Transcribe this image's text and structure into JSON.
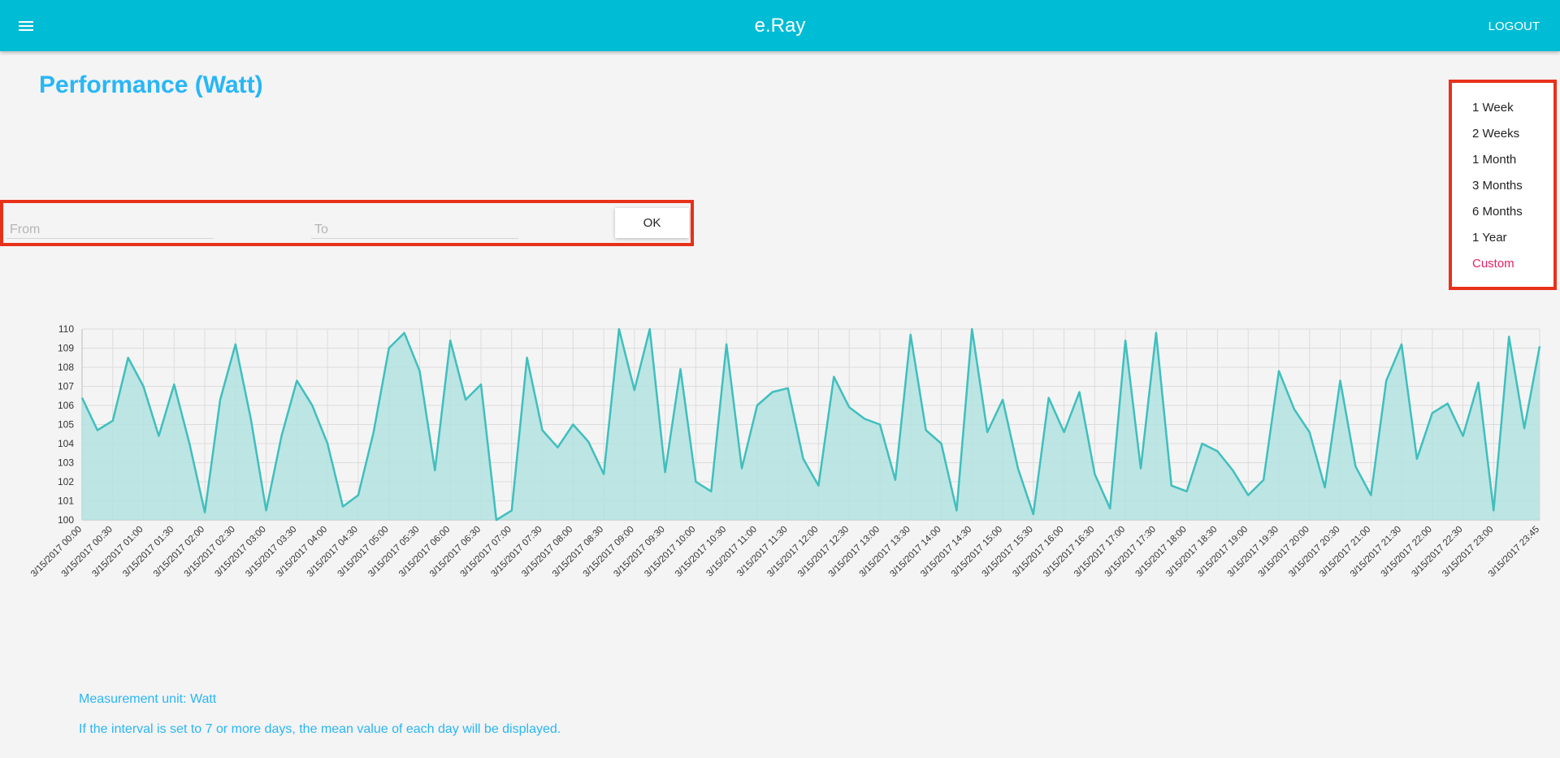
{
  "header": {
    "app_title": "e.Ray",
    "logout_label": "LOGOUT",
    "menu_icon": "menu-icon"
  },
  "page": {
    "title": "Performance (Watt)"
  },
  "filter": {
    "from_placeholder": "From",
    "to_placeholder": "To",
    "ok_label": "OK"
  },
  "ranges": [
    {
      "label": "1 Week",
      "active": false
    },
    {
      "label": "2 Weeks",
      "active": false
    },
    {
      "label": "1 Month",
      "active": false
    },
    {
      "label": "3 Months",
      "active": false
    },
    {
      "label": "6 Months",
      "active": false
    },
    {
      "label": "1 Year",
      "active": false
    },
    {
      "label": "Custom",
      "active": true
    }
  ],
  "colors": {
    "header": "#00bcd4",
    "accent": "#29b6f6",
    "active_range": "#e91e63",
    "line": "#3fbfbd",
    "fill": "#b2e2e1",
    "highlight_box": "#e8311a"
  },
  "notes": {
    "unit": "Measurement unit: Watt",
    "interval": "If the interval is set to 7 or more days, the mean value of each day will be displayed."
  },
  "chart_data": {
    "type": "area",
    "title": "",
    "xlabel": "",
    "ylabel": "",
    "ylim": [
      100,
      110
    ],
    "grid": true,
    "x_date": "3/15/2017",
    "x": [
      "00:00",
      "00:15",
      "00:30",
      "00:45",
      "01:00",
      "01:15",
      "01:30",
      "01:45",
      "02:00",
      "02:15",
      "02:30",
      "02:45",
      "03:00",
      "03:15",
      "03:30",
      "03:45",
      "04:00",
      "04:15",
      "04:30",
      "04:45",
      "05:00",
      "05:15",
      "05:30",
      "05:45",
      "06:00",
      "06:15",
      "06:30",
      "06:45",
      "07:00",
      "07:15",
      "07:30",
      "07:45",
      "08:00",
      "08:15",
      "08:30",
      "08:45",
      "09:00",
      "09:15",
      "09:30",
      "09:45",
      "10:00",
      "10:15",
      "10:30",
      "10:45",
      "11:00",
      "11:15",
      "11:30",
      "11:45",
      "12:00",
      "12:15",
      "12:30",
      "12:45",
      "13:00",
      "13:15",
      "13:30",
      "13:45",
      "14:00",
      "14:15",
      "14:30",
      "14:45",
      "15:00",
      "15:15",
      "15:30",
      "15:45",
      "16:00",
      "16:15",
      "16:30",
      "16:45",
      "17:00",
      "17:15",
      "17:30",
      "17:45",
      "18:00",
      "18:15",
      "18:30",
      "18:45",
      "19:00",
      "19:15",
      "19:30",
      "19:45",
      "20:00",
      "20:15",
      "20:30",
      "20:45",
      "21:00",
      "21:15",
      "21:30",
      "21:45",
      "22:00",
      "22:15",
      "22:30",
      "22:45",
      "23:00",
      "23:15",
      "23:30",
      "23:45"
    ],
    "x_tick_labels": [
      "3/15/2017  00:00",
      "3/15/2017  00:30",
      "3/15/2017  01:00",
      "3/15/2017  01:30",
      "3/15/2017  02:00",
      "3/15/2017  02:30",
      "3/15/2017  03:00",
      "3/15/2017  03:30",
      "3/15/2017  04:00",
      "3/15/2017  04:30",
      "3/15/2017  05:00",
      "3/15/2017  05:30",
      "3/15/2017  06:00",
      "3/15/2017  06:30",
      "3/15/2017  07:00",
      "3/15/2017  07:30",
      "3/15/2017  08:00",
      "3/15/2017  08:30",
      "3/15/2017  09:00",
      "3/15/2017  09:30",
      "3/15/2017  10:00",
      "3/15/2017  10:30",
      "3/15/2017  11:00",
      "3/15/2017  11:30",
      "3/15/2017  12:00",
      "3/15/2017  12:30",
      "3/15/2017  13:00",
      "3/15/2017  13:30",
      "3/15/2017  14:00",
      "3/15/2017  14:30",
      "3/15/2017  15:00",
      "3/15/2017  15:30",
      "3/15/2017  16:00",
      "3/15/2017  16:30",
      "3/15/2017  17:00",
      "3/15/2017  17:30",
      "3/15/2017  18:00",
      "3/15/2017  18:30",
      "3/15/2017  19:00",
      "3/15/2017  19:30",
      "3/15/2017  20:00",
      "3/15/2017  20:30",
      "3/15/2017  21:00",
      "3/15/2017  21:30",
      "3/15/2017  22:00",
      "3/15/2017  22:30",
      "3/15/2017  23:00",
      "3/15/2017  23:45"
    ],
    "y_ticks": [
      100,
      101,
      102,
      103,
      104,
      105,
      106,
      107,
      108,
      109,
      110
    ],
    "values": [
      106.4,
      104.7,
      105.2,
      108.5,
      107.0,
      104.4,
      107.1,
      104.0,
      100.4,
      106.3,
      109.2,
      105.3,
      100.5,
      104.4,
      107.3,
      106.0,
      104.0,
      100.7,
      101.3,
      104.6,
      109.0,
      109.8,
      107.8,
      102.6,
      109.4,
      106.3,
      107.1,
      100.0,
      100.5,
      108.5,
      104.7,
      103.8,
      105.0,
      104.1,
      102.4,
      110.0,
      106.8,
      110.0,
      102.5,
      107.9,
      102.0,
      101.5,
      109.2,
      102.7,
      106.0,
      106.7,
      106.9,
      103.2,
      101.8,
      107.5,
      105.9,
      105.3,
      105.0,
      102.1,
      109.7,
      104.7,
      104.0,
      100.5,
      110.0,
      104.6,
      106.3,
      102.7,
      100.3,
      106.4,
      104.6,
      106.7,
      102.4,
      100.6,
      109.4,
      102.7,
      109.8,
      101.8,
      101.5,
      104.0,
      103.6,
      102.6,
      101.3,
      102.1,
      107.8,
      105.8,
      104.6,
      101.7,
      107.3,
      102.8,
      101.3,
      107.3,
      109.2,
      103.2,
      105.6,
      106.1,
      104.4,
      107.2,
      100.5,
      109.6,
      104.8,
      109.1
    ]
  }
}
